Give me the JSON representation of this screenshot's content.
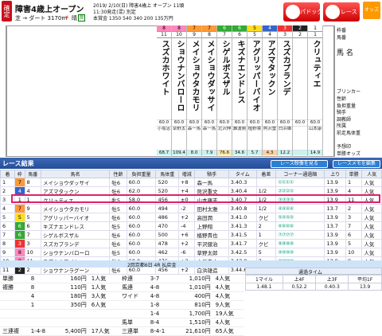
{
  "header": {
    "kakutei": "確定",
    "title": "障害4歳上オープン",
    "date_line": "2019/ 2/10(日)  障害4歳上 オープン  11頭",
    "start_line": "11:30発走(混) 別定",
    "prize_line": "本賞金 1350 540 340 200 135万円",
    "course": "芝 → ダート 3170m",
    "weather_icon": "sun-icon",
    "weather": "晴",
    "baba": "良",
    "pad_label": "パドック",
    "race_label": "レース",
    "odds_label": "オッズ"
  },
  "right_labels": [
    "枠番",
    "馬番",
    "",
    "馬 名",
    "",
    "",
    "",
    "",
    "",
    "ブリンカー",
    "性齢",
    "負担重量",
    "騎手",
    "調教師",
    "所属",
    "前走馬体重",
    "",
    "予想印",
    "単勝オッズ"
  ],
  "horses": [
    {
      "waku": "8",
      "uma": "11",
      "name": "スズカホワイト",
      "kin": "60.0",
      "jockey": "小坂忠",
      "trainer": "",
      "odds": "68.7",
      "oc": "oddsc"
    },
    {
      "waku": "8",
      "uma": "10",
      "name": "ショウナンバローロ",
      "kin": "60.0",
      "jockey": "草野太",
      "trainer": "",
      "odds": "109.4",
      "oc": "oddsc"
    },
    {
      "waku": "7",
      "uma": "9",
      "name": "メイショウタカモリ",
      "kin": "60.0",
      "jockey": "森一馬",
      "trainer": "",
      "odds": "8.0",
      "oc": "oddsc"
    },
    {
      "waku": "7",
      "uma": "8",
      "name": "メイショウダッサイ",
      "kin": "60.0",
      "jockey": "森一馬",
      "trainer": "",
      "odds": "7.9",
      "oc": "oddsc"
    },
    {
      "waku": "6",
      "uma": "7",
      "name": "シゲルボスザル",
      "kin": "60.0",
      "jockey": "北沢伸",
      "trainer": "",
      "odds": "76.6",
      "oc": "oddsh"
    },
    {
      "waku": "6",
      "uma": "6",
      "name": "キズナエンドレス",
      "kin": "60.0",
      "jockey": "難波剛",
      "trainer": "",
      "odds": "34.6",
      "oc": "oddsc"
    },
    {
      "waku": "5",
      "uma": "5",
      "name": "アグリッパーバイオ",
      "kin": "60.0",
      "jockey": "植野貴",
      "trainer": "",
      "odds": "5.7",
      "oc": "oddsc"
    },
    {
      "waku": "4",
      "uma": "4",
      "name": "アズマタックン",
      "kin": "60.0",
      "jockey": "熊沢重",
      "trainer": "",
      "odds": "4.3",
      "oc": "oddsm"
    },
    {
      "waku": "3",
      "uma": "3",
      "name": "スズカプランデ",
      "kin": "60.0",
      "jockey": "白浜雄",
      "trainer": "",
      "odds": "12.2",
      "oc": "oddsc"
    },
    {
      "waku": "2",
      "uma": "2",
      "name": "",
      "kin": "60.0",
      "jockey": "",
      "trainer": "",
      "odds": "",
      "oc": "oddsc"
    },
    {
      "waku": "1",
      "uma": "1",
      "name": "クリュティエ",
      "kin": "60.0",
      "jockey": "山本康",
      "trainer": "",
      "odds": "14.9",
      "oc": "oddsc"
    }
  ],
  "results": {
    "title": "レース結果",
    "video_label": "レース映像を見る",
    "memo_label": "レースメモを編集",
    "headers": [
      "着",
      "枠",
      "馬番",
      "馬名",
      "性齢",
      "負担重量",
      "馬体重",
      "増減",
      "騎手",
      "タイム",
      "着差",
      "コーナー通過順",
      "上り",
      "単勝",
      "人気"
    ],
    "rows": [
      [
        "1",
        "7",
        "8",
        "メイショウダッサイ",
        "牡6",
        "60.0",
        "520",
        "+8",
        "森一馬",
        "3.40.3",
        "",
        "①①①①",
        "13.9",
        "1",
        "人気"
      ],
      [
        "2",
        "4",
        "4",
        "アズマタックン",
        "牡6",
        "62.0",
        "520",
        "+4",
        "熊沢重文",
        "3.40.4",
        "1/2",
        "②②②②",
        "13.9",
        "4",
        "人気"
      ],
      [
        "3",
        "1",
        "1",
        "クリュティエ",
        "牝5",
        "58.0",
        "456",
        "±0",
        "山本康志",
        "3.40.7",
        "1/2",
        "③③③③",
        "13.9",
        "11",
        "人気"
      ],
      [
        "4",
        "7",
        "9",
        "メイショウタカモリ",
        "牡5",
        "60.0",
        "494",
        "-2",
        "田村太雅",
        "3.40.8",
        "1/2",
        "④④④④",
        "13.7",
        "2",
        "人気"
      ],
      [
        "5",
        "5",
        "5",
        "アグリッパーバイオ",
        "牡6",
        "60.0",
        "486",
        "+2",
        "高田潤",
        "3.41.0",
        "クビ",
        "⑤⑤⑤⑤",
        "13.9",
        "3",
        "人気"
      ],
      [
        "6",
        "6",
        "6",
        "キズナエンドレス",
        "牡5",
        "60.0",
        "470",
        "-4",
        "上野翔",
        "3.41.3",
        "2",
        "⑥⑥⑥⑥",
        "13.7",
        "7",
        "人気"
      ],
      [
        "7",
        "6",
        "7",
        "シゲルボスザル",
        "牡6",
        "60.0",
        "500",
        "+6",
        "植野貴也",
        "3.41.5",
        "1",
        "⑦⑦⑦⑦",
        "13.9",
        "6",
        "人気"
      ],
      [
        "8",
        "3",
        "3",
        "スズカプランデ",
        "牡6",
        "60.0",
        "478",
        "+2",
        "平沢健治",
        "3.41.7",
        "クビ",
        "⑧⑧⑧⑧",
        "13.9",
        "5",
        "人気"
      ],
      [
        "9",
        "8",
        "10",
        "ショウナンバローロ",
        "牡5",
        "60.0",
        "462",
        "-6",
        "草野太郎",
        "3.42.5",
        "5",
        "⑨⑨⑨⑨",
        "13.9",
        "10",
        "人気"
      ],
      [
        "10",
        "8",
        "11",
        "スズカホワイト",
        "牡6",
        "60.0",
        "476",
        "+2",
        "小坂忠士",
        "3.43.0",
        "3",
        "⑩⑩⑩⑩",
        "13.9",
        "9",
        "人気"
      ],
      [
        "11",
        "2",
        "2",
        "ショウナンラグーン",
        "牡6",
        "60.0",
        "456",
        "+2",
        "白浜雄造",
        "3.44.6",
        "8",
        "⑪⑪⑪⑪",
        "13.9",
        "8",
        "人気"
      ]
    ]
  },
  "payout": {
    "title": "2回京都6日 4R 払戻金",
    "rows": [
      [
        "単勝",
        "8",
        "160円",
        "1人気",
        "枠連",
        "3-7",
        "1,010円",
        "4人気"
      ],
      [
        "複勝",
        "8",
        "110円",
        "1人気",
        "馬連",
        "4-8",
        "1,010円",
        "4人気"
      ],
      [
        "",
        "4",
        "180円",
        "3人気",
        "ワイド",
        "4-8",
        "400円",
        "4人気"
      ],
      [
        "",
        "1",
        "350円",
        "6人気",
        "",
        "1-8",
        "810円",
        "9人気"
      ],
      [
        "",
        "",
        "",
        "",
        "",
        "1-4",
        "1,700円",
        "19人気"
      ],
      [
        "",
        "",
        "",
        "",
        "馬単",
        "8-4",
        "1,510円",
        "4人気"
      ],
      [
        "三連複",
        "1-4-8",
        "5,400円",
        "17人気",
        "三連単",
        "8-4-1",
        "21,610円",
        "65人気"
      ]
    ]
  },
  "laps": {
    "title": "通過タイム",
    "headers": [
      "1マイル",
      "上4F",
      "上3F",
      "平均1F"
    ],
    "values": [
      "1.48.1",
      "0.52.2",
      "0.40.3",
      "13.9"
    ]
  }
}
